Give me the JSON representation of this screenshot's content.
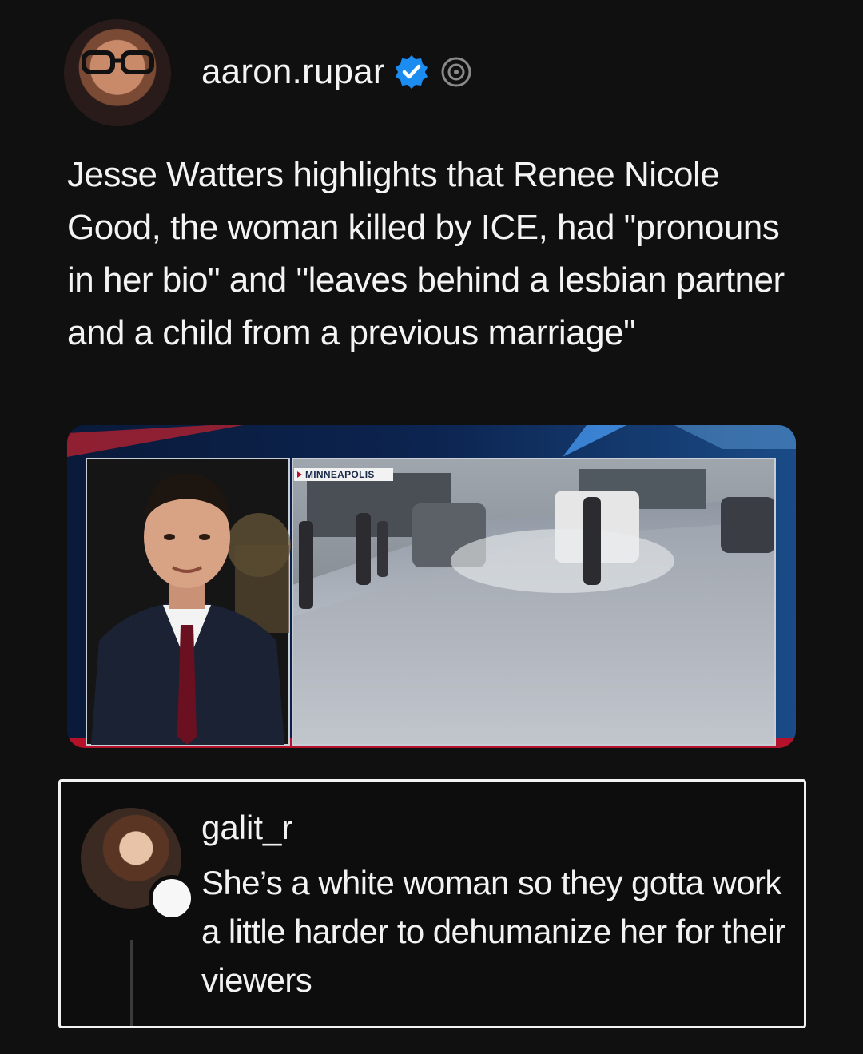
{
  "post": {
    "username": "aaron.rupar",
    "text": "Jesse Watters highlights that Renee Nicole Good, the woman killed by ICE, had \"pronouns in her bio\" and \"leaves behind a lesbian partner and a child from a previous marriage\"",
    "media": {
      "location_chyron": "MINNEAPOLIS"
    }
  },
  "reply": {
    "username": "galit_r",
    "text": "She’s a white woman so they gotta work a little harder to dehumanize her for their viewers"
  },
  "colors": {
    "background": "#101010",
    "verified_blue": "#1d8cf0",
    "text": "#f2f2f2"
  },
  "icons": [
    "verified-badge-icon",
    "threads-icon"
  ]
}
